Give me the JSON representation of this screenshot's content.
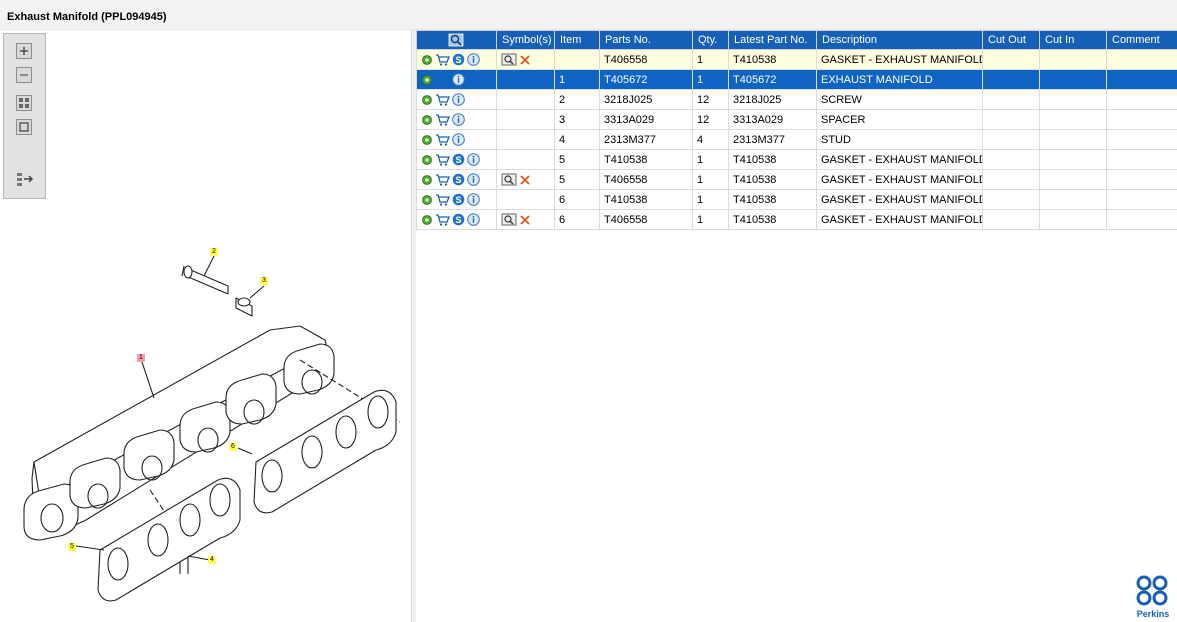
{
  "window": {
    "title": "Exhaust Manifold (PPL094945)"
  },
  "toolbox": {
    "buttons": [
      "zoom-in-icon",
      "zoom-out-icon",
      "fit-all-icon",
      "fit-window-icon",
      "export-icon"
    ]
  },
  "diagram": {
    "callouts": [
      "1",
      "2",
      "3",
      "4",
      "5",
      "6"
    ]
  },
  "table": {
    "columns": [
      "Symbol(s)",
      "Item",
      "Parts No.",
      "Qty.",
      "Latest Part No.",
      "Description",
      "Cut Out",
      "Cut In",
      "Comment"
    ],
    "rows": [
      {
        "symbols": true,
        "item": "",
        "part": "T406558",
        "qty": "1",
        "latest": "T410538",
        "desc": "GASKET - EXHAUST MANIFOLD",
        "cutout": "",
        "cutin": "",
        "comment": "",
        "state": "highlight",
        "s_icon": true
      },
      {
        "symbols": false,
        "item": "1",
        "part": "T405672",
        "qty": "1",
        "latest": "T405672",
        "desc": "EXHAUST MANIFOLD",
        "cutout": "",
        "cutin": "",
        "comment": "",
        "state": "selected",
        "s_icon": false
      },
      {
        "symbols": false,
        "item": "2",
        "part": "3218J025",
        "qty": "12",
        "latest": "3218J025",
        "desc": "SCREW",
        "cutout": "",
        "cutin": "",
        "comment": "",
        "state": "",
        "s_icon": false
      },
      {
        "symbols": false,
        "item": "3",
        "part": "3313A029",
        "qty": "12",
        "latest": "3313A029",
        "desc": "SPACER",
        "cutout": "",
        "cutin": "",
        "comment": "",
        "state": "",
        "s_icon": false
      },
      {
        "symbols": false,
        "item": "4",
        "part": "2313M377",
        "qty": "4",
        "latest": "2313M377",
        "desc": "STUD",
        "cutout": "",
        "cutin": "",
        "comment": "",
        "state": "",
        "s_icon": false
      },
      {
        "symbols": false,
        "item": "5",
        "part": "T410538",
        "qty": "1",
        "latest": "T410538",
        "desc": "GASKET - EXHAUST MANIFOLD",
        "cutout": "",
        "cutin": "",
        "comment": "",
        "state": "",
        "s_icon": true
      },
      {
        "symbols": true,
        "item": "5",
        "part": "T406558",
        "qty": "1",
        "latest": "T410538",
        "desc": "GASKET - EXHAUST MANIFOLD",
        "cutout": "",
        "cutin": "",
        "comment": "",
        "state": "",
        "s_icon": true
      },
      {
        "symbols": false,
        "item": "6",
        "part": "T410538",
        "qty": "1",
        "latest": "T410538",
        "desc": "GASKET - EXHAUST MANIFOLD",
        "cutout": "",
        "cutin": "",
        "comment": "",
        "state": "",
        "s_icon": true
      },
      {
        "symbols": true,
        "item": "6",
        "part": "T406558",
        "qty": "1",
        "latest": "T410538",
        "desc": "GASKET - EXHAUST MANIFOLD",
        "cutout": "",
        "cutin": "",
        "comment": "",
        "state": "",
        "s_icon": true
      }
    ]
  },
  "brand": {
    "name": "Perkins",
    "color": "#1560b6"
  },
  "colors": {
    "header": "#1560b6",
    "selected_row": "#0f64c3",
    "highlight_row": "#ffffdf"
  }
}
